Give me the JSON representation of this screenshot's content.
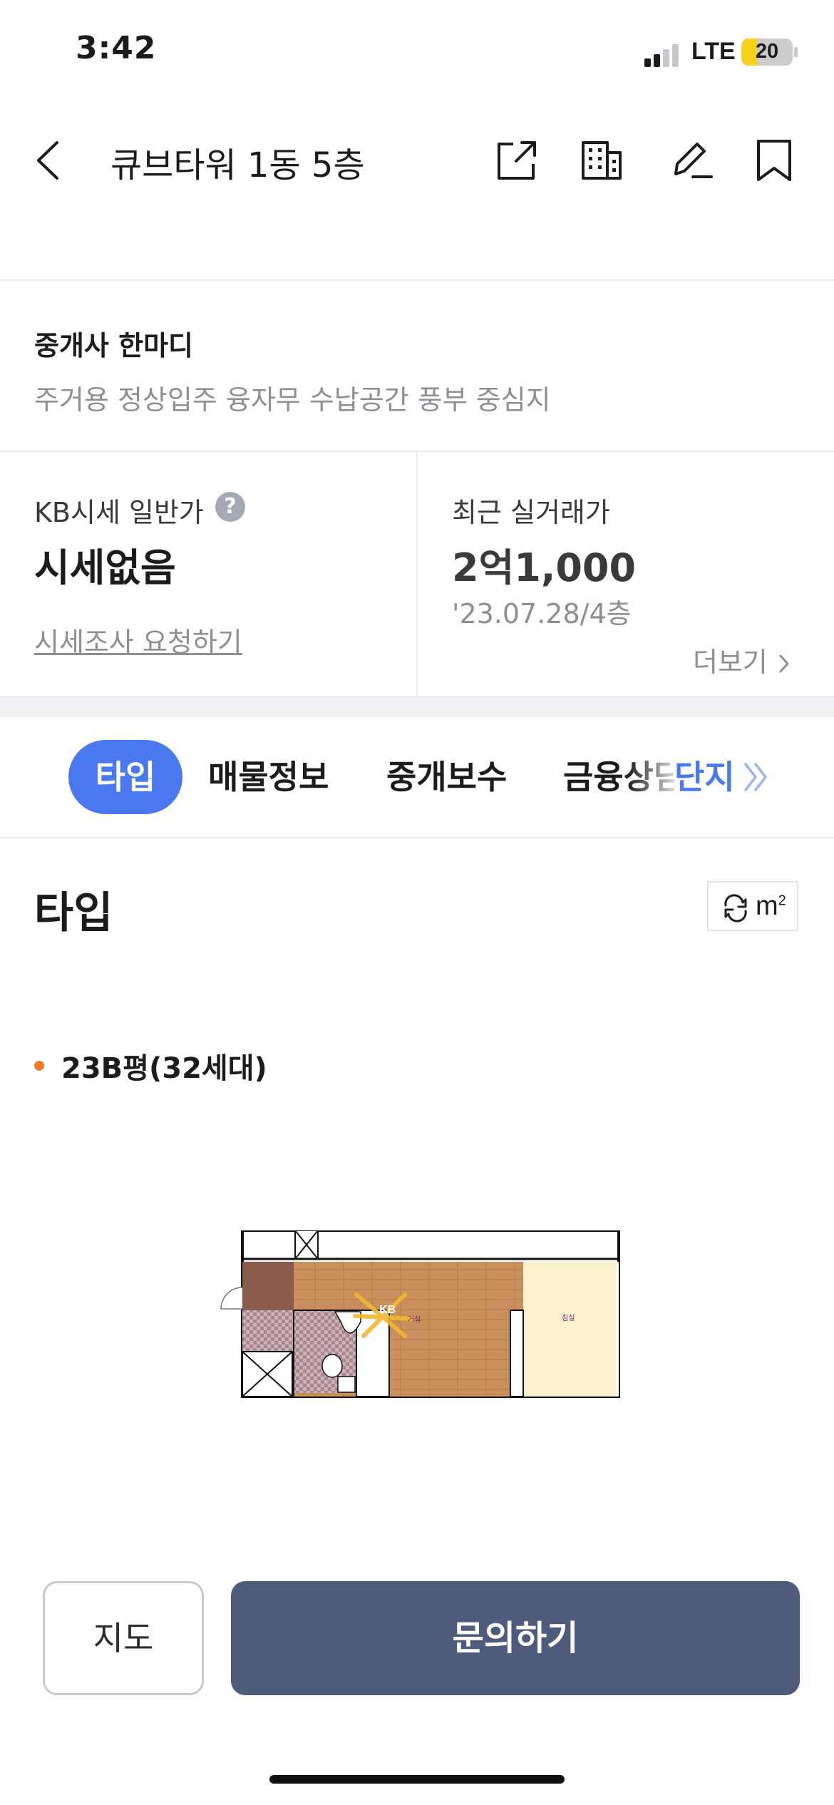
{
  "status_bar": {
    "time": "3:42",
    "network": "LTE",
    "battery": "20"
  },
  "nav": {
    "title": "큐브타워 1동 5층",
    "icons": [
      "chevron-left-icon",
      "share-icon",
      "building-icon",
      "edit-icon",
      "bookmark-icon"
    ]
  },
  "agent_note": {
    "label": "중개사 한마디",
    "comment": "주거용 정상입주 융자무 수납공간 풍부 중심지"
  },
  "price": {
    "kb_label": "KB시세 일반가",
    "kb_help": "?",
    "kb_value": "시세없음",
    "kb_request": "시세조사 요청하기",
    "recent_label": "최근 실거래가",
    "recent_value": "2억1,000",
    "recent_date": "'23.07.28/4층",
    "more": "더보기"
  },
  "tabs": {
    "items": [
      "타입",
      "매물정보",
      "중개보수",
      "금융상담",
      "단지"
    ],
    "active": "타입"
  },
  "type_section": {
    "title": "타입",
    "unit_toggle": "m",
    "unit_sup": "2",
    "type_name": "23B평(32세대)",
    "floorplan_labels": {
      "living": "거실",
      "bedroom": "침실",
      "watermark": "KB"
    }
  },
  "bottom": {
    "map_button": "지도",
    "inquiry_button": "문의하기"
  },
  "colors": {
    "accent": "#4a78f0",
    "inquiry_button": "#4f5b7a",
    "bullet": "#f07a2a",
    "battery_fill": "#f7d21c"
  }
}
